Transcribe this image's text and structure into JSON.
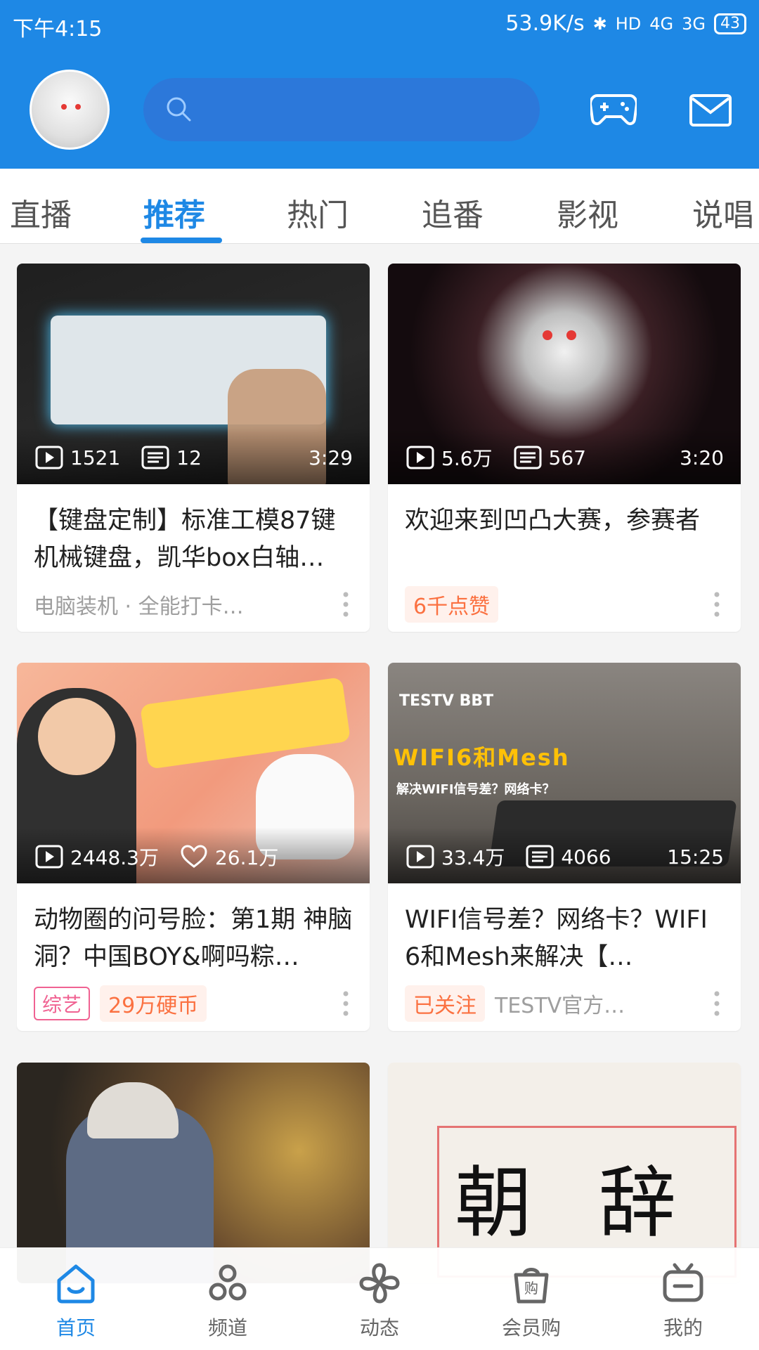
{
  "status_bar": {
    "time": "下午4:15",
    "speed": "53.9K/s",
    "hd": "HD",
    "net1": "4G",
    "net2": "3G",
    "battery": "43"
  },
  "header": {
    "search_placeholder": ""
  },
  "tabs": [
    "直播",
    "推荐",
    "热门",
    "追番",
    "影视",
    "说唱"
  ],
  "active_tab": 1,
  "cards": [
    {
      "views": "1521",
      "danmaku": "12",
      "duration": "3:29",
      "title": "【键盘定制】标准工模87键机械键盘，凯华box白轴…",
      "meta": "电脑装机 · 全能打卡…"
    },
    {
      "views": "5.6万",
      "danmaku": "567",
      "duration": "3:20",
      "title": "欢迎来到凹凸大赛，参赛者",
      "tag_orange": "6千点赞"
    },
    {
      "views": "2448.3万",
      "likes": "26.1万",
      "title": "动物圈的问号脸：第1期 神脑洞？中国BOY&啊吗粽…",
      "tag_pink": "综艺",
      "tag_orange": "29万硬币"
    },
    {
      "views": "33.4万",
      "danmaku": "4066",
      "duration": "15:25",
      "title": "WIFI信号差？网络卡？WIFI 6和Mesh来解决【…",
      "tag_orange": "已关注",
      "meta": "TESTV官方…",
      "thumb_text_brand": "TESTV BBT",
      "thumb_text_main": "WIFI6和Mesh",
      "thumb_text_sub": "解决WIFI信号差？网络卡？"
    },
    {
      "thumb_caption": ""
    },
    {
      "thumb_text": "朝 辞"
    }
  ],
  "bottom_nav": [
    {
      "label": "首页",
      "icon": "home-icon"
    },
    {
      "label": "频道",
      "icon": "channel-icon"
    },
    {
      "label": "动态",
      "icon": "pinwheel-icon"
    },
    {
      "label": "会员购",
      "icon": "shopping-bag-icon"
    },
    {
      "label": "我的",
      "icon": "tv-icon"
    }
  ],
  "colors": {
    "brand_blue": "#1e88e5",
    "accent_orange": "#fb7141",
    "accent_pink": "#f06292"
  }
}
